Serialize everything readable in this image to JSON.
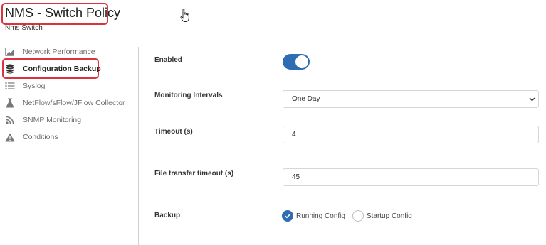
{
  "header": {
    "title": "NMS - Switch Policy",
    "subtitle": "Nms Switch"
  },
  "sidebar": {
    "items": [
      {
        "label": "Network Performance",
        "icon": "chart-icon",
        "active": false
      },
      {
        "label": "Configuration Backup",
        "icon": "database-icon",
        "active": true
      },
      {
        "label": "Syslog",
        "icon": "list-icon",
        "active": false
      },
      {
        "label": "NetFlow/sFlow/JFlow Collector",
        "icon": "flask-icon",
        "active": false
      },
      {
        "label": "SNMP Monitoring",
        "icon": "rss-icon",
        "active": false
      },
      {
        "label": "Conditions",
        "icon": "warning-icon",
        "active": false
      }
    ]
  },
  "form": {
    "enabled": {
      "label": "Enabled",
      "value": true
    },
    "monitoring_intervals": {
      "label": "Monitoring Intervals",
      "value": "One Day"
    },
    "timeout": {
      "label": "Timeout (s)",
      "value": "4"
    },
    "file_transfer_timeout": {
      "label": "File transfer timeout (s)",
      "value": "45"
    },
    "backup": {
      "label": "Backup",
      "options": [
        {
          "label": "Running Config",
          "checked": true
        },
        {
          "label": "Startup Config",
          "checked": false
        }
      ]
    }
  },
  "colors": {
    "accent": "#2f6db3",
    "highlight_outline": "#d9333f"
  }
}
